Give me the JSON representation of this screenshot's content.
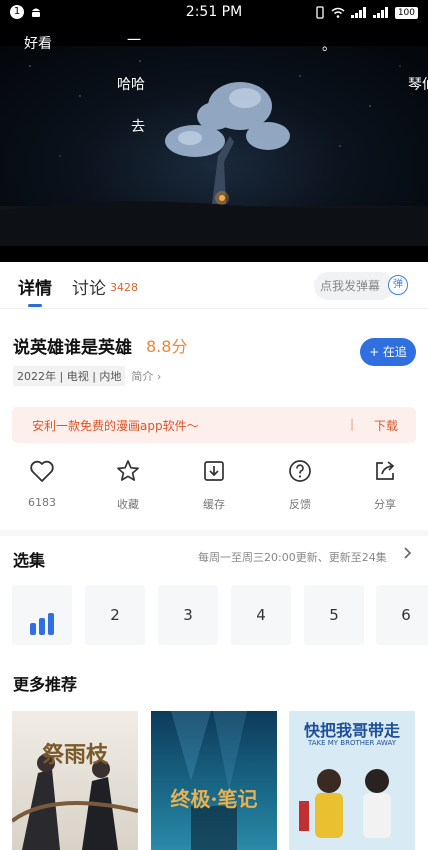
{
  "status_bar": {
    "time": "2:51 PM",
    "notification_count": "1",
    "battery": "100"
  },
  "danmaku": [
    {
      "text": "好看"
    },
    {
      "text": "一"
    },
    {
      "text": "。"
    },
    {
      "text": "哈哈"
    },
    {
      "text": "琴仙"
    },
    {
      "text": "去"
    }
  ],
  "tabs": {
    "detail": "详情",
    "discuss": "讨论",
    "discuss_count": "3428",
    "danmaku_placeholder": "点我发弹幕",
    "danmaku_button": "弹"
  },
  "show": {
    "title": "说英雄谁是英雄",
    "rating": "8.8分",
    "meta_tags": "2022年 | 电视 | 内地",
    "intro": "简介 ›",
    "follow_label": "+ 在追"
  },
  "ad": {
    "text": "安利一款免费的漫画app软件〜",
    "separator": "|",
    "download": "下载"
  },
  "actions": [
    {
      "label": "6183",
      "icon": "heart-icon"
    },
    {
      "label": "收藏",
      "icon": "star-icon"
    },
    {
      "label": "缓存",
      "icon": "download-icon"
    },
    {
      "label": "反馈",
      "icon": "question-icon"
    },
    {
      "label": "分享",
      "icon": "share-icon"
    }
  ],
  "episodes": {
    "title": "选集",
    "update_info": "每周一至周三20:00更新、更新至24集",
    "items": [
      "2",
      "3",
      "4",
      "5",
      "6"
    ],
    "playing_icon": "playing-bars-icon"
  },
  "recommend": {
    "title": "更多推荐",
    "posters": [
      {
        "title": "祭雨枝"
      },
      {
        "title": "终极·笔记"
      },
      {
        "title": "快把我哥带走",
        "subtitle": "TAKE MY BROTHER AWAY"
      }
    ]
  },
  "colors": {
    "accent": "#2f6fe0",
    "rating": "#f0853a",
    "ad_text": "#e0542a",
    "ad_bg": "#fdf0ec"
  }
}
